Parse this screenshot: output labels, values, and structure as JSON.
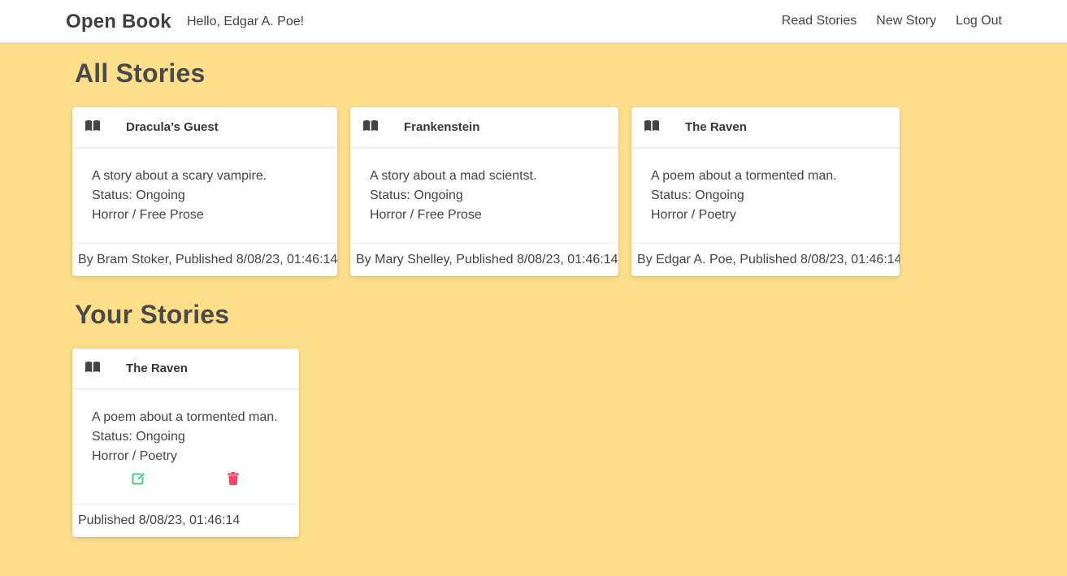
{
  "navbar": {
    "brand": "Open Book",
    "greeting": "Hello, Edgar A. Poe!",
    "links": [
      "Read Stories",
      "New Story",
      "Log Out"
    ]
  },
  "all_stories": {
    "title": "All Stories",
    "cards": [
      {
        "icon": "book-open-icon",
        "title": "Dracula’s Guest",
        "description": "A story about a scary vampire.",
        "status": "Status: Ongoing",
        "genre": "Horror / Free Prose",
        "footer": "By Bram Stoker, Published 8/08/23, 01:46:14"
      },
      {
        "icon": "book-open-icon",
        "title": "Frankenstein",
        "description": "A story about a mad scientst.",
        "status": "Status: Ongoing",
        "genre": "Horror / Free Prose",
        "footer": "By Mary Shelley, Published 8/08/23, 01:46:14"
      },
      {
        "icon": "book-open-icon",
        "title": "The Raven",
        "description": "A poem about a tormented man.",
        "status": "Status: Ongoing",
        "genre": "Horror / Poetry",
        "footer": "By Edgar A. Poe, Published 8/08/23, 01:46:14"
      }
    ]
  },
  "your_stories": {
    "title": "Your Stories",
    "cards": [
      {
        "icon": "book-open-icon",
        "title": "The Raven",
        "description": "A poem about a tormented man.",
        "status": "Status: Ongoing",
        "genre": "Horror / Poetry",
        "footer": "Published 8/08/23, 01:46:14",
        "edit_icon": "edit-icon",
        "delete_icon": "trash-icon"
      }
    ]
  },
  "colors": {
    "background": "#fdde8b",
    "edit": "#48c78e",
    "delete": "#f14668"
  }
}
